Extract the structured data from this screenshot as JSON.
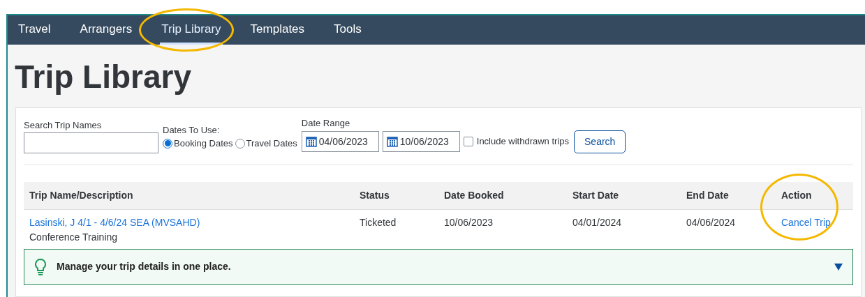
{
  "nav": {
    "tabs": [
      {
        "label": "Travel",
        "selected": false,
        "highlighted": false
      },
      {
        "label": "Arrangers",
        "selected": false,
        "highlighted": false
      },
      {
        "label": "Trip Library",
        "selected": true,
        "highlighted": true
      },
      {
        "label": "Templates",
        "selected": false,
        "highlighted": false
      },
      {
        "label": "Tools",
        "selected": false,
        "highlighted": false
      }
    ]
  },
  "page_title": "Trip Library",
  "filters": {
    "search_label": "Search Trip Names",
    "dates_label": "Dates To Use:",
    "date_options": [
      {
        "label": "Booking Dates",
        "selected": true
      },
      {
        "label": "Travel Dates",
        "selected": false
      }
    ],
    "date_range_label": "Date Range",
    "date_from": "04/06/2023",
    "date_to": "10/06/2023",
    "withdrawn": {
      "label": "Include withdrawn trips",
      "checked": false
    },
    "search_button": "Search"
  },
  "table": {
    "columns": [
      "Trip Name/Description",
      "Status",
      "Date Booked",
      "Start Date",
      "End Date",
      "Action"
    ],
    "rows": [
      {
        "trip_name": "Lasinski, J 4/1 - 4/6/24 SEA (MVSAHD)",
        "description": "Conference Training",
        "status": "Ticketed",
        "date_booked": "10/06/2023",
        "start_date": "04/01/2024",
        "end_date": "04/06/2024",
        "action": "Cancel Trip",
        "action_highlighted": true
      }
    ]
  },
  "tip": {
    "text": "Manage your trip details in one place.",
    "expanded": false
  }
}
